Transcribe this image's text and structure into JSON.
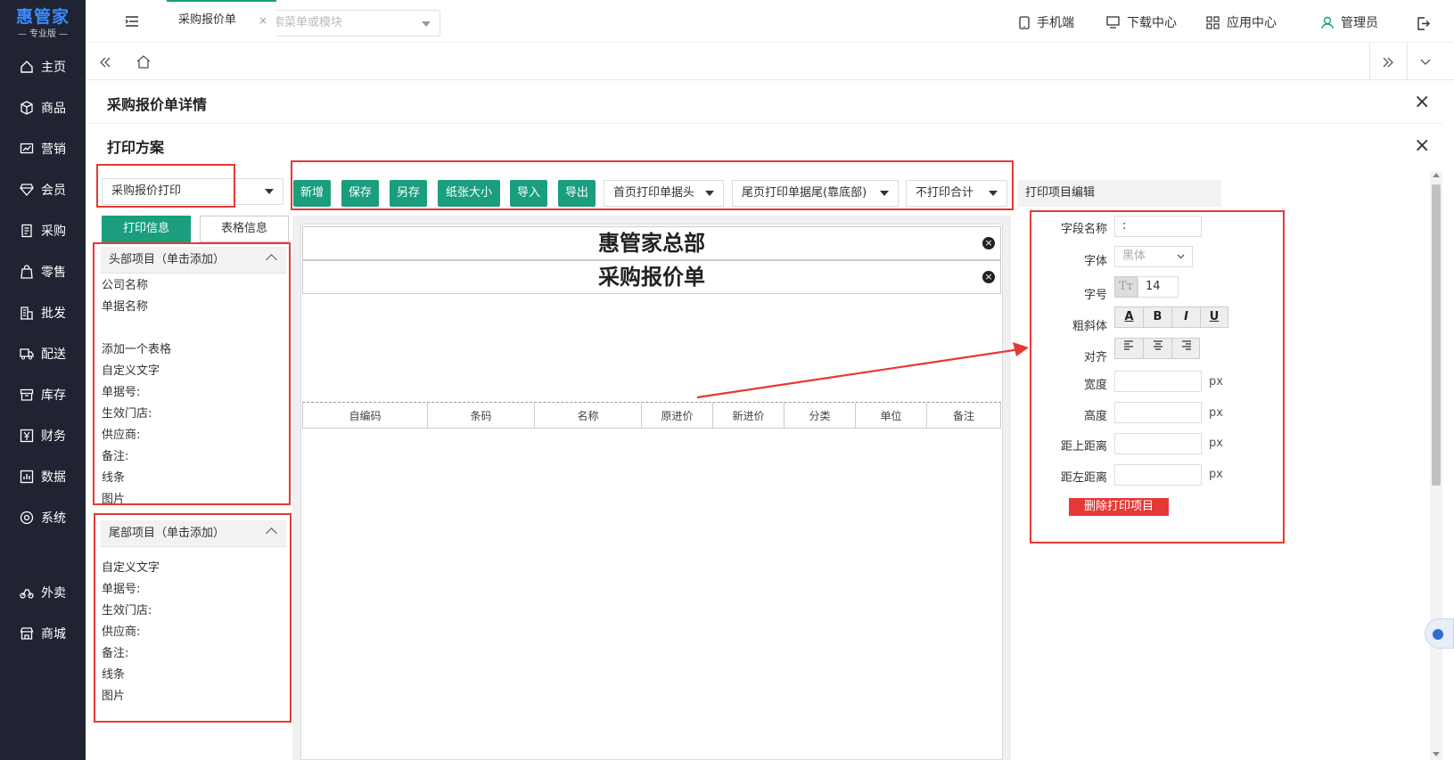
{
  "brand": {
    "name": "惠管家",
    "edition": "— 专业版 —",
    "color": "#3a8bff"
  },
  "sidebar": {
    "items": [
      {
        "label": "主页",
        "icon": "home-icon"
      },
      {
        "label": "商品",
        "icon": "box-icon"
      },
      {
        "label": "营销",
        "icon": "chart-icon"
      },
      {
        "label": "会员",
        "icon": "diamond-icon"
      },
      {
        "label": "采购",
        "icon": "receipt-icon"
      },
      {
        "label": "零售",
        "icon": "bag-icon"
      },
      {
        "label": "批发",
        "icon": "building-icon"
      },
      {
        "label": "配送",
        "icon": "truck-icon"
      },
      {
        "label": "库存",
        "icon": "archive-icon"
      },
      {
        "label": "财务",
        "icon": "yuan-icon"
      },
      {
        "label": "数据",
        "icon": "bar-chart-icon"
      },
      {
        "label": "系统",
        "icon": "settings-icon"
      },
      {
        "label": "外卖",
        "icon": "bike-icon"
      },
      {
        "label": "商城",
        "icon": "store-icon"
      }
    ]
  },
  "topbar": {
    "search_placeholder": "搜索菜单或模块",
    "mobile": "手机端",
    "download": "下载中心",
    "apps": "应用中心",
    "user": "管理员"
  },
  "tabs": {
    "active": "采购报价单"
  },
  "page": {
    "title": "采购报价单详情",
    "subtitle": "打印方案"
  },
  "scheme": {
    "selected": "采购报价打印"
  },
  "toolbar": {
    "new": "新增",
    "save": "保存",
    "save_as": "另存",
    "paper_size": "纸张大小",
    "import": "导入",
    "export": "导出",
    "first_page_header": "首页打印单据头",
    "last_page_footer": "尾页打印单据尾(靠底部)",
    "total": "不打印合计"
  },
  "left_tabs": {
    "print_info": "打印信息",
    "table_info": "表格信息"
  },
  "header_panel": {
    "title": "头部项目（单击添加）",
    "items": [
      "公司名称",
      "单据名称",
      "",
      "添加一个表格",
      "自定义文字",
      "单据号:",
      "生效门店:",
      "供应商:",
      "备注:",
      "线条",
      "图片"
    ]
  },
  "footer_panel": {
    "title": "尾部项目（单击添加）",
    "items": [
      "自定义文字",
      "单据号:",
      "生效门店:",
      "供应商:",
      "备注:",
      "线条",
      "图片"
    ]
  },
  "preview": {
    "company": "惠管家总部",
    "doc_name": "采购报价单",
    "columns": [
      "自编码",
      "条码",
      "名称",
      "原进价",
      "新进价",
      "分类",
      "单位",
      "备注"
    ]
  },
  "editor": {
    "title": "打印项目编辑",
    "field_name_label": "字段名称",
    "field_name_value": ":",
    "font_label": "字体",
    "font_value": "黑体",
    "size_label": "字号",
    "size_value": "14",
    "style_label": "粗斜体",
    "align_label": "对齐",
    "width_label": "宽度",
    "height_label": "高度",
    "top_label": "距上距离",
    "left_label": "距左距离",
    "unit": "px",
    "delete": "删除打印项目"
  },
  "colors": {
    "accent": "#1a9e7e",
    "highlight": "#e53935",
    "sidebar": "#1f2332"
  }
}
